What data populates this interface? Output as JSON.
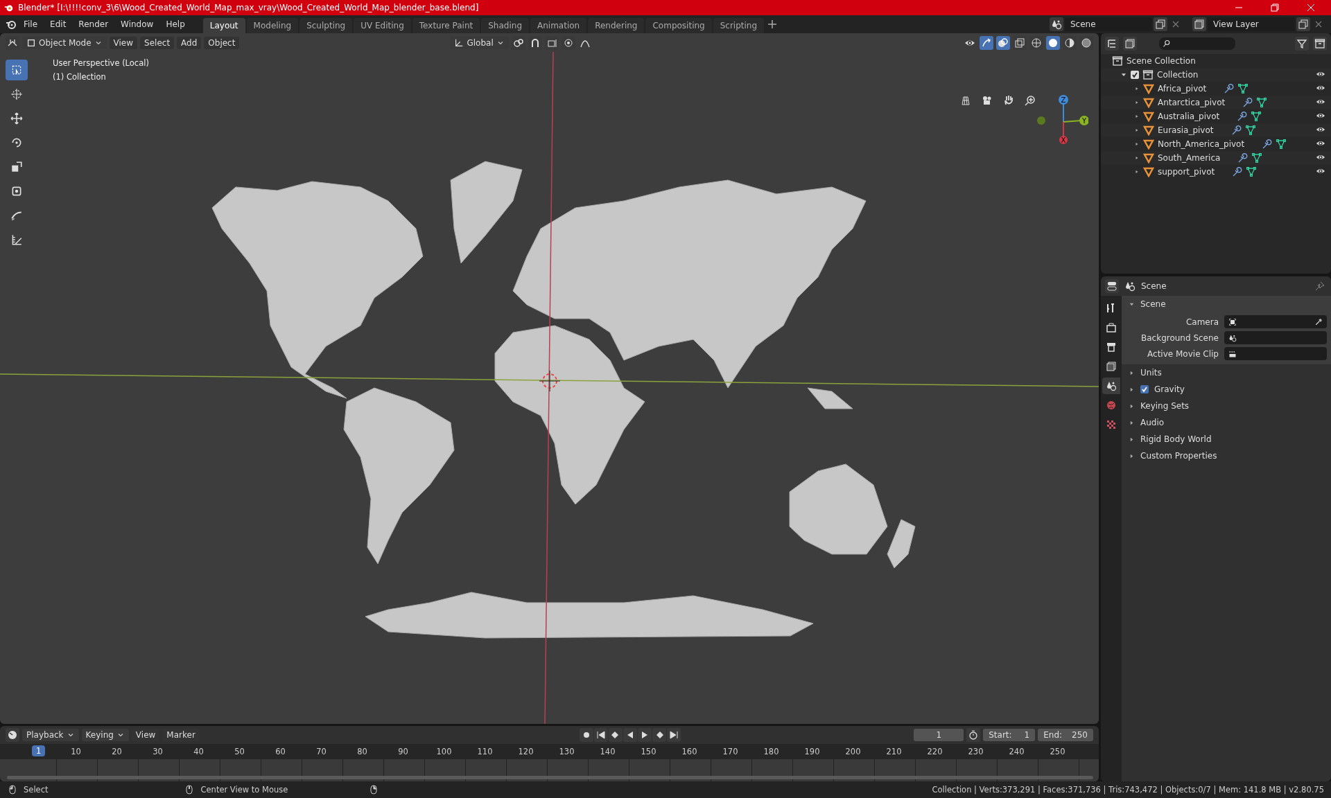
{
  "title_bar": {
    "title": "Blender* [I:\\!!!!conv_3\\6\\Wood_Created_World_Map_max_vray\\Wood_Created_World_Map_blender_base.blend]"
  },
  "menu": [
    "File",
    "Edit",
    "Render",
    "Window",
    "Help"
  ],
  "workspaces": [
    {
      "label": "Layout",
      "selected": true
    },
    {
      "label": "Modeling",
      "selected": false
    },
    {
      "label": "Sculpting",
      "selected": false
    },
    {
      "label": "UV Editing",
      "selected": false
    },
    {
      "label": "Texture Paint",
      "selected": false
    },
    {
      "label": "Shading",
      "selected": false
    },
    {
      "label": "Animation",
      "selected": false
    },
    {
      "label": "Rendering",
      "selected": false
    },
    {
      "label": "Compositing",
      "selected": false
    },
    {
      "label": "Scripting",
      "selected": false
    }
  ],
  "scene": "Scene",
  "view_layer": "View Layer",
  "viewport": {
    "mode": "Object Mode",
    "menus": [
      "View",
      "Select",
      "Add",
      "Object"
    ],
    "orientation": "Global",
    "info": [
      "User Perspective (Local)",
      "(1) Collection"
    ],
    "tools": [
      {
        "selected": true
      },
      {
        "selected": false
      },
      {
        "selected": false
      },
      {
        "selected": false
      },
      {
        "selected": false
      },
      {
        "selected": false
      },
      {
        "selected": false
      },
      {
        "selected": false
      }
    ],
    "gizmo_axes": [
      "Z",
      "Y",
      "X"
    ]
  },
  "outliner": {
    "root": "Scene Collection",
    "collection": {
      "name": "Collection",
      "expanded": true,
      "checked": true,
      "visible": true,
      "children": [
        {
          "name": "Africa_pivot",
          "visible": true
        },
        {
          "name": "Antarctica_pivot",
          "visible": true
        },
        {
          "name": "Australia_pivot",
          "visible": true
        },
        {
          "name": "Eurasia_pivot",
          "visible": true
        },
        {
          "name": "North_America_pivot",
          "visible": true
        },
        {
          "name": "South_America",
          "visible": true
        },
        {
          "name": "support_pivot",
          "visible": true
        }
      ]
    }
  },
  "properties": {
    "context": "Scene",
    "tabs": [
      {
        "selected": false
      },
      {
        "selected": false
      },
      {
        "selected": false
      },
      {
        "selected": false
      },
      {
        "selected": true
      },
      {
        "selected": false
      },
      {
        "selected": false
      }
    ],
    "panel": {
      "title": "Scene",
      "expanded": true,
      "fields": [
        {
          "label": "Camera"
        },
        {
          "label": "Background Scene"
        },
        {
          "label": "Active Movie Clip"
        }
      ]
    },
    "sections": [
      {
        "title": "Units",
        "kind": "plain",
        "expanded": false
      },
      {
        "title": "Gravity",
        "kind": "checkbox",
        "expanded": false,
        "checked": true
      },
      {
        "title": "Keying Sets",
        "kind": "plain",
        "expanded": false
      },
      {
        "title": "Audio",
        "kind": "plain",
        "expanded": false
      },
      {
        "title": "Rigid Body World",
        "kind": "plain",
        "expanded": false
      },
      {
        "title": "Custom Properties",
        "kind": "plain",
        "expanded": false
      }
    ]
  },
  "timeline": {
    "menus": [
      {
        "label": "Playback",
        "kind": "dropdown"
      },
      {
        "label": "Keying",
        "kind": "dropdown"
      },
      {
        "label": "View",
        "kind": "menu"
      },
      {
        "label": "Marker",
        "kind": "menu"
      }
    ],
    "current_frame": "1",
    "start_label": "Start:",
    "start": "1",
    "end_label": "End:",
    "end": "250",
    "playhead": "1",
    "ruler": [
      "10",
      "20",
      "30",
      "40",
      "50",
      "60",
      "70",
      "80",
      "90",
      "100",
      "110",
      "120",
      "130",
      "140",
      "150",
      "160",
      "170",
      "180",
      "190",
      "200",
      "210",
      "220",
      "230",
      "240",
      "250"
    ]
  },
  "status_bar": {
    "hints": [
      "Select",
      "Center View to Mouse"
    ],
    "stats": "Collection | Verts:373,291 | Faces:371,736 | Tris:743,472 | Objects:0/7 | Mem: 141.8 MB | v2.80.75"
  }
}
